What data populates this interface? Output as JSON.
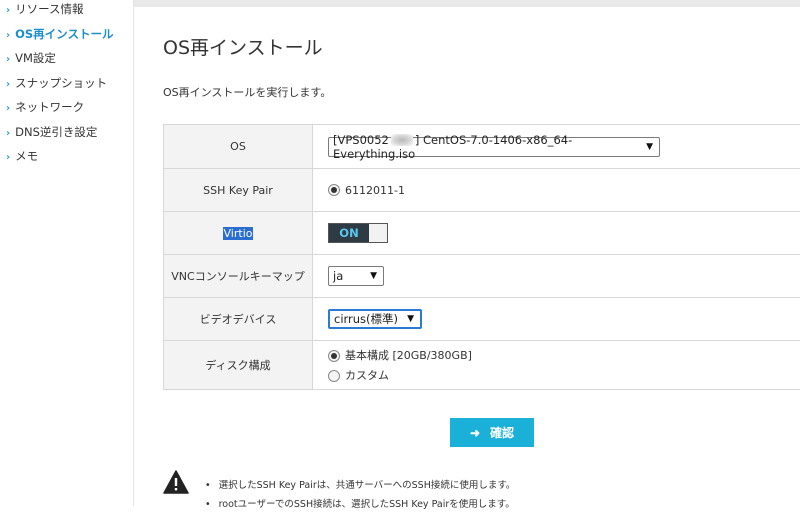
{
  "sidebar": {
    "items": [
      {
        "label": "リソース情報",
        "active": false
      },
      {
        "label": "OS再インストール",
        "active": true
      },
      {
        "label": "VM設定",
        "active": false
      },
      {
        "label": "スナップショット",
        "active": false
      },
      {
        "label": "ネットワーク",
        "active": false
      },
      {
        "label": "DNS逆引き設定",
        "active": false
      },
      {
        "label": "メモ",
        "active": false
      }
    ]
  },
  "page": {
    "title": "OS再インストール",
    "lead": "OS再インストールを実行します。"
  },
  "form": {
    "os": {
      "label": "OS",
      "value_prefix": "[VPS0052",
      "value_suffix": "] CentOS-7.0-1406-x86_64-Everything.iso"
    },
    "ssh_key": {
      "label": "SSH Key Pair",
      "option": "6112011-1"
    },
    "virtio": {
      "label": "Virtio",
      "state": "ON"
    },
    "vnc_keymap": {
      "label": "VNCコンソールキーマップ",
      "value": "ja"
    },
    "video_device": {
      "label": "ビデオデバイス",
      "value": "cirrus(標準)"
    },
    "disk": {
      "label": "ディスク構成",
      "options": [
        {
          "label": "基本構成 [20GB/380GB]",
          "checked": true
        },
        {
          "label": "カスタム",
          "checked": false
        }
      ]
    }
  },
  "confirm_button": {
    "label": "確認"
  },
  "notes": [
    "選択したSSH Key Pairは、共通サーバーへのSSH接続に使用します。",
    "rootユーザーでのSSH接続は、選択したSSH Key Pairを使用します。"
  ],
  "colors": {
    "accent": "#1ab0d8",
    "active_link": "#1b8fc8",
    "toggle_bg": "#2e3a44",
    "selection": "#2a6ed0"
  }
}
